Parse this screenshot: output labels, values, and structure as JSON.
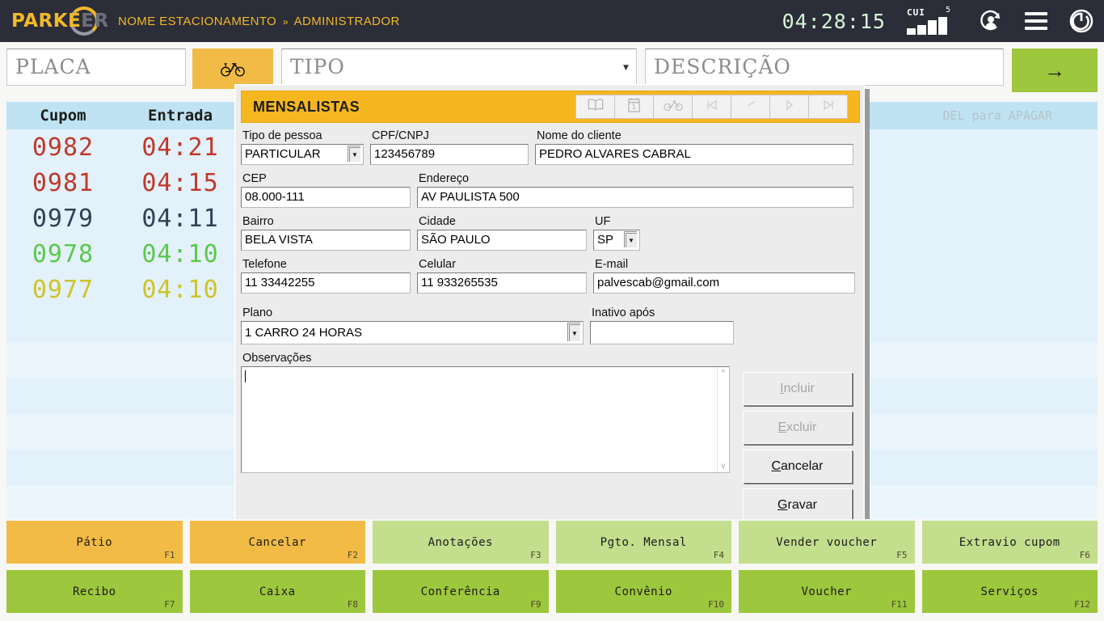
{
  "header": {
    "logo": {
      "bright": "PARKE",
      "dim": "ER"
    },
    "breadcrumb_first": "NOME ESTACIONAMENTO",
    "breadcrumb_sep": "»",
    "breadcrumb_last": "ADMINISTRADOR",
    "clock": "04:28:15",
    "signal_label": "CUI",
    "signal_count": "5",
    "icons": {
      "user": "user-icon",
      "menu": "menu-icon",
      "power": "power-icon"
    },
    "colors": {
      "bar_bg": "#2b2d38",
      "accent": "#f2b827",
      "clock": "#d8f5d8"
    }
  },
  "search": {
    "placa_placeholder": "PLACA",
    "tipo_placeholder": "TIPO",
    "descricao_placeholder": "DESCRIÇÃO",
    "bike_button": "bicycle-icon",
    "go_button": "→",
    "colors": {
      "bike_bg": "#f2bb45",
      "go_bg": "#9dc73c"
    }
  },
  "table": {
    "columns": [
      "Cupom",
      "Entrada"
    ],
    "hint": "DEL para APAGAR",
    "rows": [
      {
        "cupom": "0982",
        "entrada": "04:21",
        "color": "#c0392b"
      },
      {
        "cupom": "0981",
        "entrada": "04:15",
        "color": "#c0392b"
      },
      {
        "cupom": "0979",
        "entrada": "04:11",
        "color": "#2f4257"
      },
      {
        "cupom": "0978",
        "entrada": "04:10",
        "color": "#5cc94a"
      },
      {
        "cupom": "0977",
        "entrada": "04:10",
        "color": "#cfc42a"
      }
    ]
  },
  "modal": {
    "title": "MENSALISTAS",
    "toolbar": [
      {
        "name": "book-icon",
        "glyph": "📖"
      },
      {
        "name": "calendar-icon",
        "glyph": "🗓"
      },
      {
        "name": "bicycle-icon",
        "glyph": "🚲"
      },
      {
        "name": "first-record-icon",
        "glyph": "❙◂"
      },
      {
        "name": "previous-record-icon",
        "glyph": "◂"
      },
      {
        "name": "next-record-icon",
        "glyph": "▸"
      },
      {
        "name": "last-record-icon",
        "glyph": "▸❙"
      }
    ],
    "fields": {
      "tipo_pessoa_label": "Tipo de pessoa",
      "tipo_pessoa_value": "PARTICULAR",
      "cpf_label": "CPF/CNPJ",
      "cpf_value": "123456789",
      "nome_label": "Nome do cliente",
      "nome_value": "PEDRO ALVARES CABRAL",
      "cep_label": "CEP",
      "cep_value": "08.000-111",
      "endereco_label": "Endereço",
      "endereco_value": "AV PAULISTA 500",
      "bairro_label": "Bairro",
      "bairro_value": "BELA VISTA",
      "cidade_label": "Cidade",
      "cidade_value": "SÃO PAULO",
      "uf_label": "UF",
      "uf_value": "SP",
      "telefone_label": "Telefone",
      "telefone_value": "11 33442255",
      "celular_label": "Celular",
      "celular_value": "11 933265535",
      "email_label": "E-mail",
      "email_value": "palvescab@gmail.com",
      "plano_label": "Plano",
      "plano_value": "1 CARRO 24 HORAS",
      "inativo_label": "Inativo após",
      "inativo_value": "",
      "observacoes_label": "Observações",
      "observacoes_value": ""
    },
    "buttons": [
      {
        "label": "Incluir",
        "accel": "I",
        "enabled": false
      },
      {
        "label": "Excluir",
        "accel": "E",
        "enabled": false
      },
      {
        "label": "Cancelar",
        "accel": "C",
        "enabled": true
      },
      {
        "label": "Gravar",
        "accel": "G",
        "enabled": true
      }
    ]
  },
  "fkeys": {
    "row1": [
      {
        "label": "Pátio",
        "key": "F1",
        "color": "#f2bb45"
      },
      {
        "label": "Cancelar",
        "key": "F2",
        "color": "#f2bb45"
      },
      {
        "label": "Anotações",
        "key": "F3",
        "color": "#c3de8c"
      },
      {
        "label": "Pgto. Mensal",
        "key": "F4",
        "color": "#c3de8c"
      },
      {
        "label": "Vender voucher",
        "key": "F5",
        "color": "#c3de8c"
      },
      {
        "label": "Extravio cupom",
        "key": "F6",
        "color": "#c3de8c"
      }
    ],
    "row2": [
      {
        "label": "Recibo",
        "key": "F7",
        "color": "#9dc73c"
      },
      {
        "label": "Caixa",
        "key": "F8",
        "color": "#9dc73c"
      },
      {
        "label": "Conferência",
        "key": "F9",
        "color": "#9dc73c"
      },
      {
        "label": "Convênio",
        "key": "F10",
        "color": "#9dc73c"
      },
      {
        "label": "Voucher",
        "key": "F11",
        "color": "#9dc73c"
      },
      {
        "label": "Serviços",
        "key": "F12",
        "color": "#9dc73c"
      }
    ]
  }
}
